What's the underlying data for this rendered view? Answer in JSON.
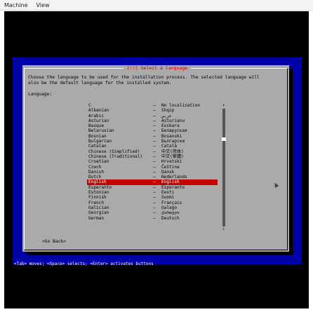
{
  "menubar": {
    "machine": "Machine",
    "view": "View"
  },
  "dialog": {
    "title": "[!!] Select a language",
    "description": "Choose the language to be used for the installation process. The selected language will\nalso be the default language for the installed system.",
    "language_label": "Language:",
    "go_back": "<Go Back>",
    "scroll_up": "↑",
    "scroll_down": "↓"
  },
  "languages": [
    {
      "name": "C",
      "native": "No localization"
    },
    {
      "name": "Albanian",
      "native": "Shqip"
    },
    {
      "name": "Arabic",
      "native": "عربي"
    },
    {
      "name": "Asturian",
      "native": "Asturianu"
    },
    {
      "name": "Basque",
      "native": "Euskara"
    },
    {
      "name": "Belarusian",
      "native": "Беларуская"
    },
    {
      "name": "Bosnian",
      "native": "Bosanski"
    },
    {
      "name": "Bulgarian",
      "native": "Български"
    },
    {
      "name": "Catalan",
      "native": "Català"
    },
    {
      "name": "Chinese (Simplified)",
      "native": "中文(简体)"
    },
    {
      "name": "Chinese (Traditional)",
      "native": "中文(繁體)"
    },
    {
      "name": "Croatian",
      "native": "Hrvatski"
    },
    {
      "name": "Czech",
      "native": "Čeština"
    },
    {
      "name": "Danish",
      "native": "Dansk"
    },
    {
      "name": "Dutch",
      "native": "Nederlands"
    },
    {
      "name": "English",
      "native": "English",
      "selected": true
    },
    {
      "name": "Esperanto",
      "native": "Esperanto"
    },
    {
      "name": "Estonian",
      "native": "Eesti"
    },
    {
      "name": "Finnish",
      "native": "Suomi"
    },
    {
      "name": "French",
      "native": "Français"
    },
    {
      "name": "Galician",
      "native": "Galego"
    },
    {
      "name": "Georgian",
      "native": "ქართული"
    },
    {
      "name": "German",
      "native": "Deutsch"
    }
  ],
  "footer": {
    "help": "<Tab> moves; <Space> selects; <Enter> activates buttons"
  },
  "colors": {
    "blue": "#0000a8",
    "dialog": "#aaaaaa",
    "selected": "#c80000",
    "title": "#c00000"
  }
}
